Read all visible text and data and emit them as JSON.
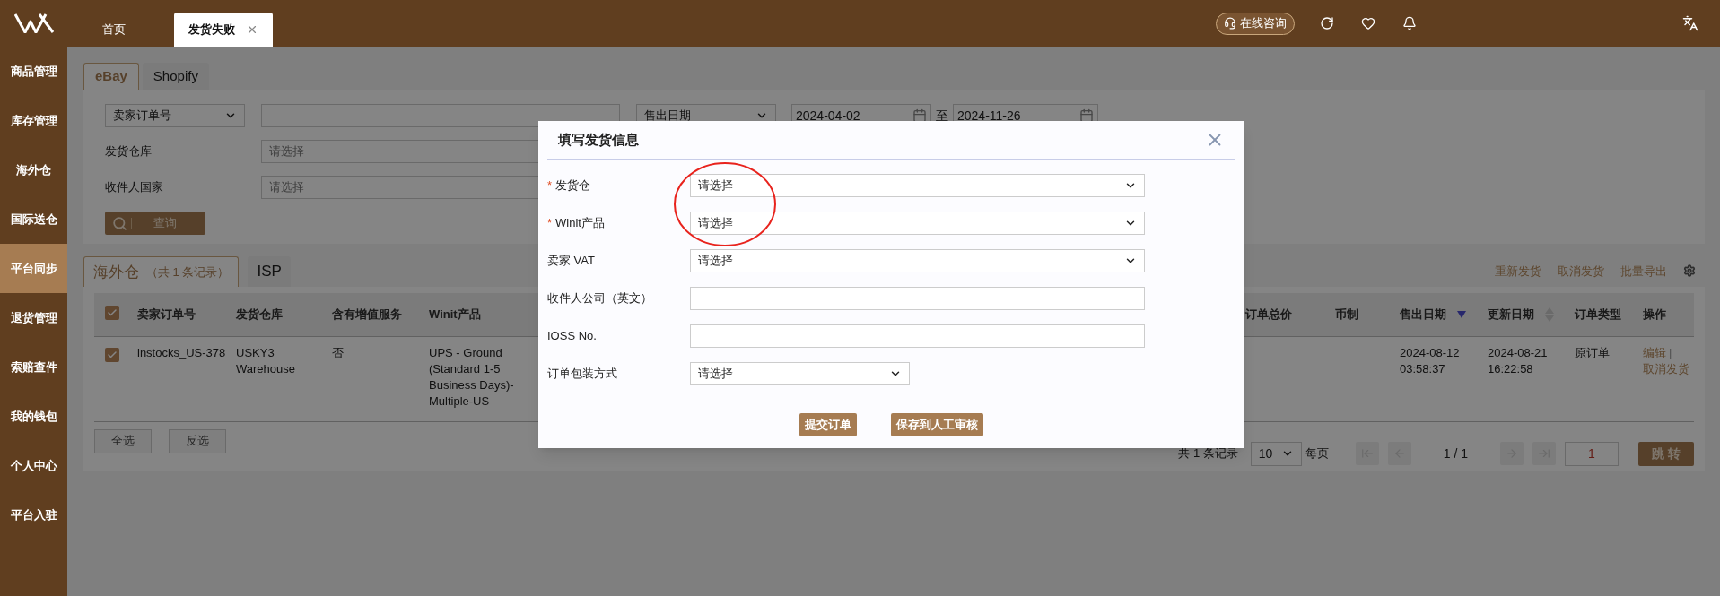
{
  "top_bar": {
    "tabs": [
      {
        "label": "首页",
        "selected": false,
        "closable": false
      },
      {
        "label": "发货失败",
        "selected": true,
        "closable": true
      }
    ],
    "consult_button": "在线咨询"
  },
  "sidebar": {
    "items": [
      {
        "label": "商品管理",
        "selected": false
      },
      {
        "label": "库存管理",
        "selected": false
      },
      {
        "label": "海外仓",
        "selected": false
      },
      {
        "label": "国际送仓",
        "selected": false
      },
      {
        "label": "平台同步",
        "selected": true
      },
      {
        "label": "退货管理",
        "selected": false
      },
      {
        "label": "索赔查件",
        "selected": false
      },
      {
        "label": "我的钱包",
        "selected": false
      },
      {
        "label": "个人中心",
        "selected": false
      },
      {
        "label": "平台入驻",
        "selected": false
      }
    ]
  },
  "platform_tabs": [
    {
      "label": "eBay",
      "selected": true
    },
    {
      "label": "Shopify",
      "selected": false
    }
  ],
  "filters": {
    "search_type": "卖家订单号",
    "date_type": "售出日期",
    "date_from": "2024-04-02",
    "date_separator": "至",
    "date_to": "2024-11-26",
    "rows": [
      {
        "label": "发货仓库",
        "placeholder": "请选择"
      },
      {
        "label": "收件人国家",
        "placeholder": "请选择"
      }
    ],
    "query_button": "查询"
  },
  "result_tabs": [
    {
      "label": "海外仓",
      "note": "（共 1 条记录）",
      "selected": true
    },
    {
      "label": "ISP",
      "selected": false
    }
  ],
  "actions": [
    "重新发货",
    "取消发货",
    "批量导出"
  ],
  "table": {
    "all_checked": true,
    "columns_left": [
      "卖家订单号",
      "发货仓库",
      "含有增值服务",
      "Winit产品"
    ],
    "columns_right": [
      {
        "label": "订单总价"
      },
      {
        "label": "币制"
      },
      {
        "label": "售出日期",
        "sortable": true,
        "sort_active": true
      },
      {
        "label": "更新日期",
        "sortable": true,
        "sort_active": false
      },
      {
        "label": "订单类型"
      },
      {
        "label": "操作"
      }
    ],
    "action_separator": "|",
    "rows": [
      {
        "checked": true,
        "cells_left": [
          "instocks_US-378",
          "USKY3 Warehouse",
          "否",
          "UPS - Ground (Standard 1-5 Business Days)-Multiple-US"
        ],
        "sold_date": "2024-08-12 03:58:37",
        "updated_date": "2024-08-21 16:22:58",
        "order_type": "原订单",
        "actions": [
          "编辑",
          "取消发货"
        ]
      }
    ]
  },
  "bulk_buttons": [
    "全选",
    "反选"
  ],
  "pagination": {
    "total": "共 1 条记录",
    "page_size": "10",
    "per_page_label": "每页",
    "page_info": "1 / 1",
    "page_input": "1",
    "go_button": "跳 转"
  },
  "dialog": {
    "title": "填写发货信息",
    "required_mark": "*",
    "fields": [
      {
        "label": "发货仓",
        "required": true,
        "kind": "select",
        "value": "请选择"
      },
      {
        "label": "Winit产品",
        "required": true,
        "kind": "select",
        "value": "请选择"
      },
      {
        "label": "卖家 VAT",
        "required": false,
        "kind": "select",
        "value": "请选择"
      },
      {
        "label": "收件人公司（英文）",
        "required": false,
        "kind": "text"
      },
      {
        "label": "IOSS No.",
        "required": false,
        "kind": "text"
      },
      {
        "label": "订单包装方式",
        "required": false,
        "kind": "select",
        "value": "请选择"
      }
    ],
    "buttons": [
      "提交订单",
      "保存到人工审核"
    ]
  }
}
